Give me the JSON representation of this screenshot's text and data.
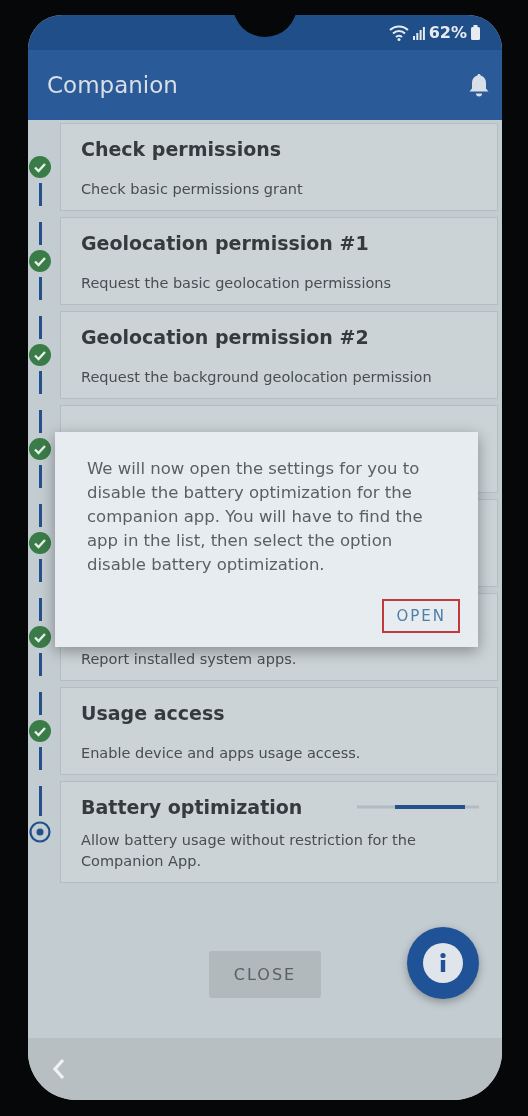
{
  "status_bar": {
    "battery": "62%"
  },
  "app_bar": {
    "title": "Companion"
  },
  "steps": [
    {
      "title": "Check permissions",
      "description": "Check basic permissions grant",
      "completed": true,
      "in_progress": false
    },
    {
      "title": "Geolocation permission #1",
      "description": "Request the basic geolocation permissions",
      "completed": true,
      "in_progress": false
    },
    {
      "title": "Geolocation permission #2",
      "description": "Request the background geolocation permission",
      "completed": true,
      "in_progress": false
    },
    {
      "completed": true,
      "in_progress": false
    },
    {
      "completed": true,
      "in_progress": false
    },
    {
      "description": "Report installed system apps.",
      "completed": true,
      "in_progress": false
    },
    {
      "title": "Usage access",
      "description": "Enable device and apps usage access.",
      "completed": true,
      "in_progress": false
    },
    {
      "title": "Battery optimization",
      "description": "Allow battery usage without restriction for the Companion App.",
      "completed": false,
      "in_progress": true
    }
  ],
  "dialog": {
    "message": "We will now open the settings for you to disable the battery optimization for the companion app. You will have to find the app in the list, then select the option disable battery optimization.",
    "button": "OPEN"
  },
  "close_button": "CLOSE"
}
